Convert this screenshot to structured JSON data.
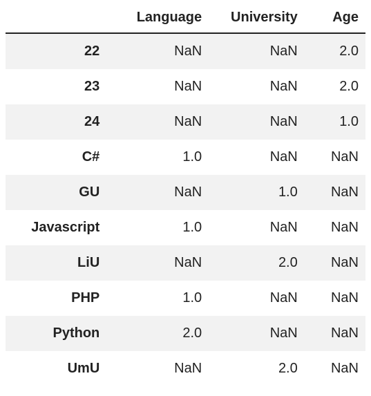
{
  "chart_data": {
    "type": "table",
    "title": "",
    "columns": [
      "Language",
      "University",
      "Age"
    ],
    "index": [
      "22",
      "23",
      "24",
      "C#",
      "GU",
      "Javascript",
      "LiU",
      "PHP",
      "Python",
      "UmU"
    ],
    "rows": [
      [
        "NaN",
        "NaN",
        "2.0"
      ],
      [
        "NaN",
        "NaN",
        "2.0"
      ],
      [
        "NaN",
        "NaN",
        "1.0"
      ],
      [
        "1.0",
        "NaN",
        "NaN"
      ],
      [
        "NaN",
        "1.0",
        "NaN"
      ],
      [
        "1.0",
        "NaN",
        "NaN"
      ],
      [
        "NaN",
        "2.0",
        "NaN"
      ],
      [
        "1.0",
        "NaN",
        "NaN"
      ],
      [
        "2.0",
        "NaN",
        "NaN"
      ],
      [
        "NaN",
        "2.0",
        "NaN"
      ]
    ]
  }
}
